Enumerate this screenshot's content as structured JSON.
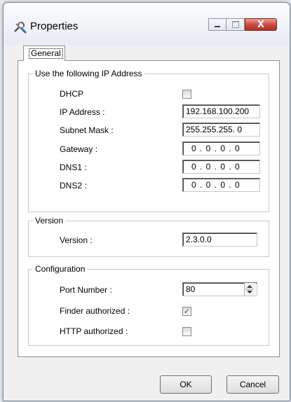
{
  "window": {
    "title": "Properties",
    "icon": "properties-tools-icon",
    "close_glyph": "X"
  },
  "tab": {
    "label": "General"
  },
  "ip_group": {
    "title": "Use the following IP Address",
    "dhcp_label": "DHCP",
    "dhcp_checked": false,
    "ip_label": "IP Address :",
    "ip_value": "192.168.100.200",
    "subnet_label": "Subnet Mask :",
    "subnet_value": "255.255.255. 0",
    "gateway_label": "Gateway :",
    "gateway_value": "0 . 0 . 0 . 0",
    "dns1_label": "DNS1 :",
    "dns1_value": "0 . 0 . 0 . 0",
    "dns2_label": "DNS2 :",
    "dns2_value": "0 . 0 . 0 . 0"
  },
  "version_group": {
    "title": "Version",
    "version_label": "Version :",
    "version_value": "2.3.0.0"
  },
  "config_group": {
    "title": "Configuration",
    "port_label": "Port Number :",
    "port_value": "80",
    "finder_label": "Finder authorized :",
    "finder_checked": true,
    "finder_mark": "✓",
    "http_label": "HTTP authorized :",
    "http_checked": false
  },
  "buttons": {
    "ok": "OK",
    "cancel": "Cancel"
  }
}
